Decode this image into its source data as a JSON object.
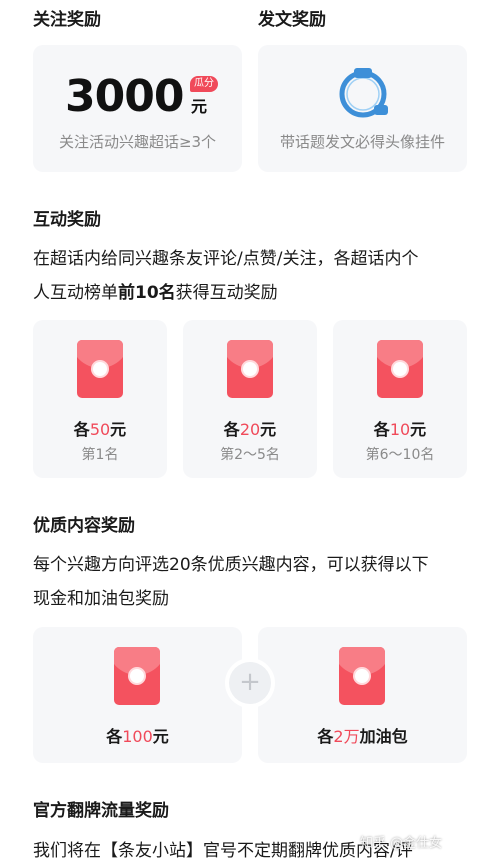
{
  "sections": {
    "follow": {
      "title": "关注奖励",
      "amount": "3000",
      "unit": "元",
      "badge": "瓜分",
      "desc": "关注活动兴趣超话≥3个"
    },
    "post": {
      "title": "发文奖励",
      "desc": "带话题发文必得头像挂件"
    },
    "interact": {
      "title": "互动奖励",
      "line1": "在超话内给同兴趣条友评论/点赞/关注，各超话内个",
      "line2_pre": "人互动榜单",
      "line2_bold": "前10名",
      "line2_post": "获得互动奖励",
      "cards": [
        {
          "prefix": "各",
          "num": "50",
          "suffix": "元",
          "rank": "第1名"
        },
        {
          "prefix": "各",
          "num": "20",
          "suffix": "元",
          "rank": "第2～5名"
        },
        {
          "prefix": "各",
          "num": "10",
          "suffix": "元",
          "rank": "第6～10名"
        }
      ]
    },
    "quality": {
      "title": "优质内容奖励",
      "line1": "每个兴趣方向评选20条优质兴趣内容，可以获得以下",
      "line2": "现金和加油包奖励",
      "plus": "+",
      "cards": [
        {
          "prefix": "各",
          "num": "100",
          "suffix": "元"
        },
        {
          "prefix": "各",
          "num": "2万",
          "suffix": "加油包"
        }
      ]
    },
    "traffic": {
      "title": "官方翻牌流量奖励",
      "line1": "我们将在【条友小站】官号不定期翻牌优质内容/评"
    }
  },
  "watermark": "知乎 @金仕女",
  "colors": {
    "accent": "#f04a5a",
    "envelope": "#f4525f",
    "card": "#f6f7f9",
    "ring": "#3d8fd8"
  }
}
